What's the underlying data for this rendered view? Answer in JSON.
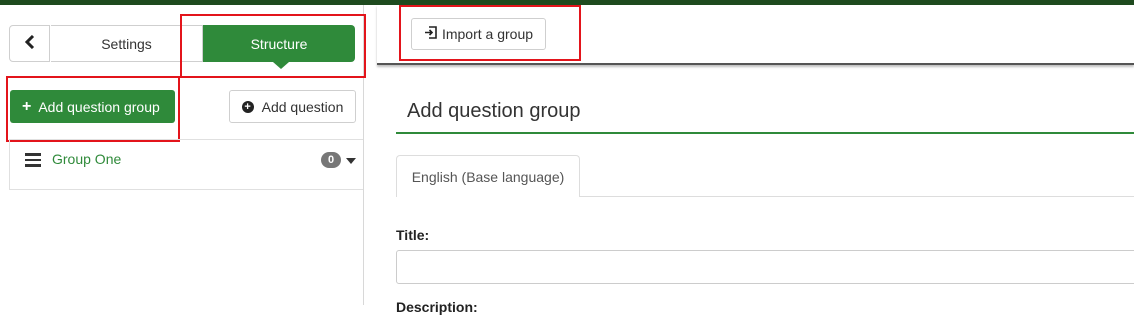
{
  "sidebar": {
    "back_icon": "chevron-left-icon",
    "tabs": [
      {
        "label": "Settings",
        "active": false
      },
      {
        "label": "Structure",
        "active": true
      }
    ],
    "add_group_label": "Add question group",
    "add_question_label": "Add question",
    "groups": [
      {
        "name": "Group One",
        "question_count": "0"
      }
    ]
  },
  "main": {
    "import_label": "Import a group",
    "panel_title": "Add question group",
    "language_tab": "English (Base language)",
    "title_label": "Title:",
    "title_value": "",
    "description_label": "Description:"
  },
  "colors": {
    "accent": "#2f8a3a",
    "highlight": "#e3141b",
    "topbar": "#1e4a1e"
  }
}
